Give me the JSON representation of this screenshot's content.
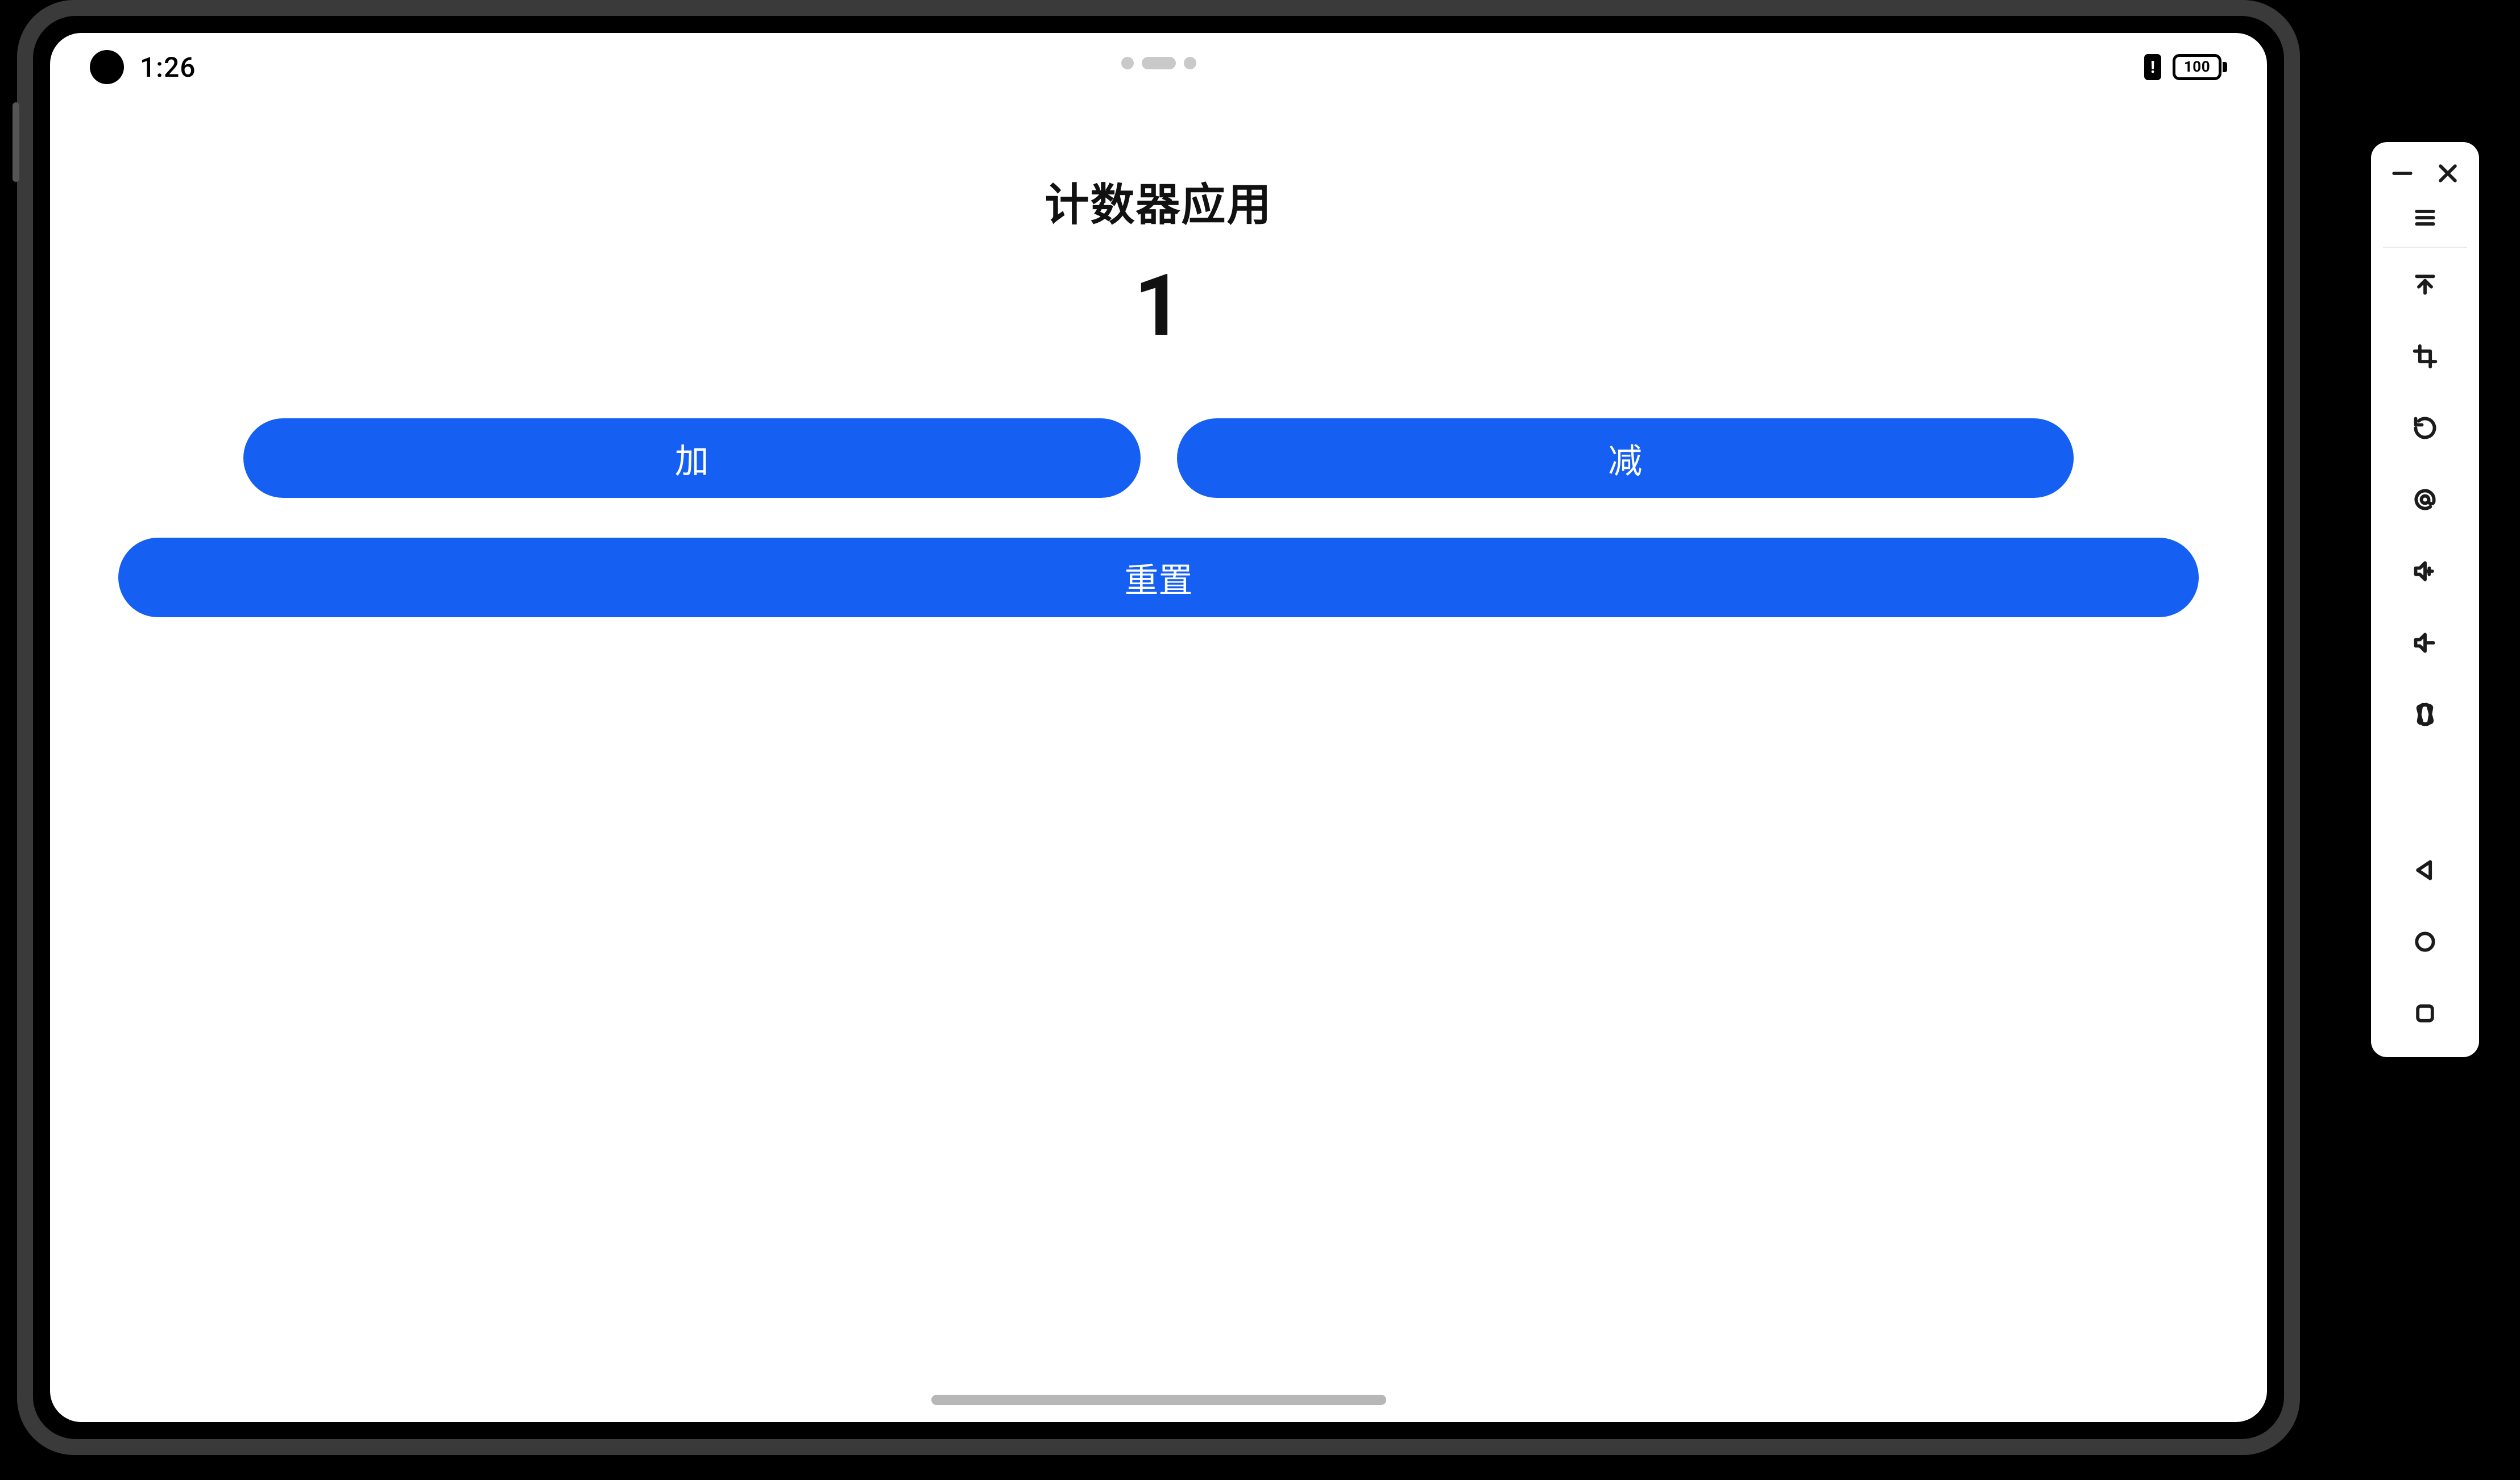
{
  "status": {
    "time": "1:26",
    "battery_level": "100"
  },
  "app": {
    "title": "计数器应用",
    "counter_value": "1",
    "buttons": {
      "increment": "加",
      "decrement": "减",
      "reset": "重置"
    }
  },
  "emulator_toolbar": {
    "icons": {
      "minimize": "minimize",
      "close": "close",
      "menu": "hamburger-menu",
      "upload": "arrow-up-to-line",
      "crop": "crop",
      "restart": "rotate-ccw",
      "location": "at-sign",
      "vol_up": "volume-up",
      "vol_down": "volume-down",
      "rotate": "rotate-device",
      "back": "triangle-back",
      "home": "circle-home",
      "overview": "square-overview"
    }
  }
}
